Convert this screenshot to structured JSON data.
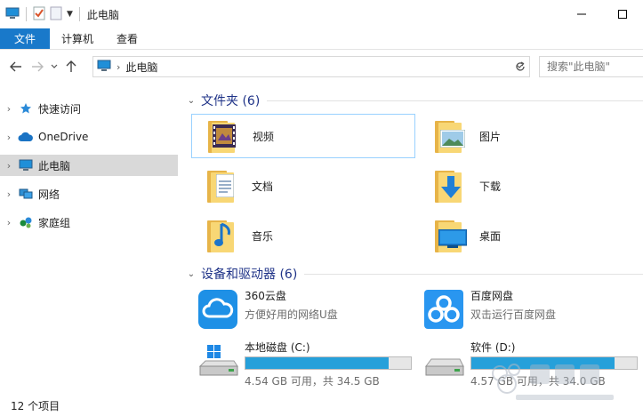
{
  "window": {
    "title": "此电脑"
  },
  "ribbon": {
    "tabs": [
      {
        "label": "文件"
      },
      {
        "label": "计算机"
      },
      {
        "label": "查看"
      }
    ]
  },
  "address": {
    "path": "此电脑",
    "search_placeholder": "搜索\"此电脑\""
  },
  "sidebar": {
    "items": [
      {
        "label": "快速访问",
        "icon": "star-icon"
      },
      {
        "label": "OneDrive",
        "icon": "cloud-icon"
      },
      {
        "label": "此电脑",
        "icon": "computer-icon",
        "selected": true
      },
      {
        "label": "网络",
        "icon": "network-icon"
      },
      {
        "label": "家庭组",
        "icon": "homegroup-icon"
      }
    ]
  },
  "groups": {
    "folders": {
      "title": "文件夹 (6)",
      "items": [
        {
          "label": "视频",
          "icon": "video-folder-icon"
        },
        {
          "label": "图片",
          "icon": "pictures-folder-icon"
        },
        {
          "label": "文档",
          "icon": "documents-folder-icon"
        },
        {
          "label": "下载",
          "icon": "downloads-folder-icon"
        },
        {
          "label": "音乐",
          "icon": "music-folder-icon"
        },
        {
          "label": "桌面",
          "icon": "desktop-folder-icon"
        }
      ]
    },
    "devices": {
      "title": "设备和驱动器 (6)",
      "items": [
        {
          "name": "360云盘",
          "sub": "方便好用的网络U盘",
          "icon": "360-cloud-icon"
        },
        {
          "name": "百度网盘",
          "sub": "双击运行百度网盘",
          "icon": "baidu-netdisk-icon"
        },
        {
          "name": "本地磁盘 (C:)",
          "sub": "4.54 GB 可用，共 34.5 GB",
          "used_fraction": 0.868,
          "icon": "windows-drive-icon"
        },
        {
          "name": "软件 (D:)",
          "sub": "4.57 GB 可用，共 34.0 GB",
          "used_fraction": 0.866,
          "icon": "hard-drive-icon"
        }
      ]
    }
  },
  "status": {
    "item_count": "12 个项目"
  },
  "colors": {
    "accent": "#1979ca",
    "group_title": "#1e3287",
    "bar_fill": "#26a0da",
    "selected_bg": "#d9d9d9"
  }
}
